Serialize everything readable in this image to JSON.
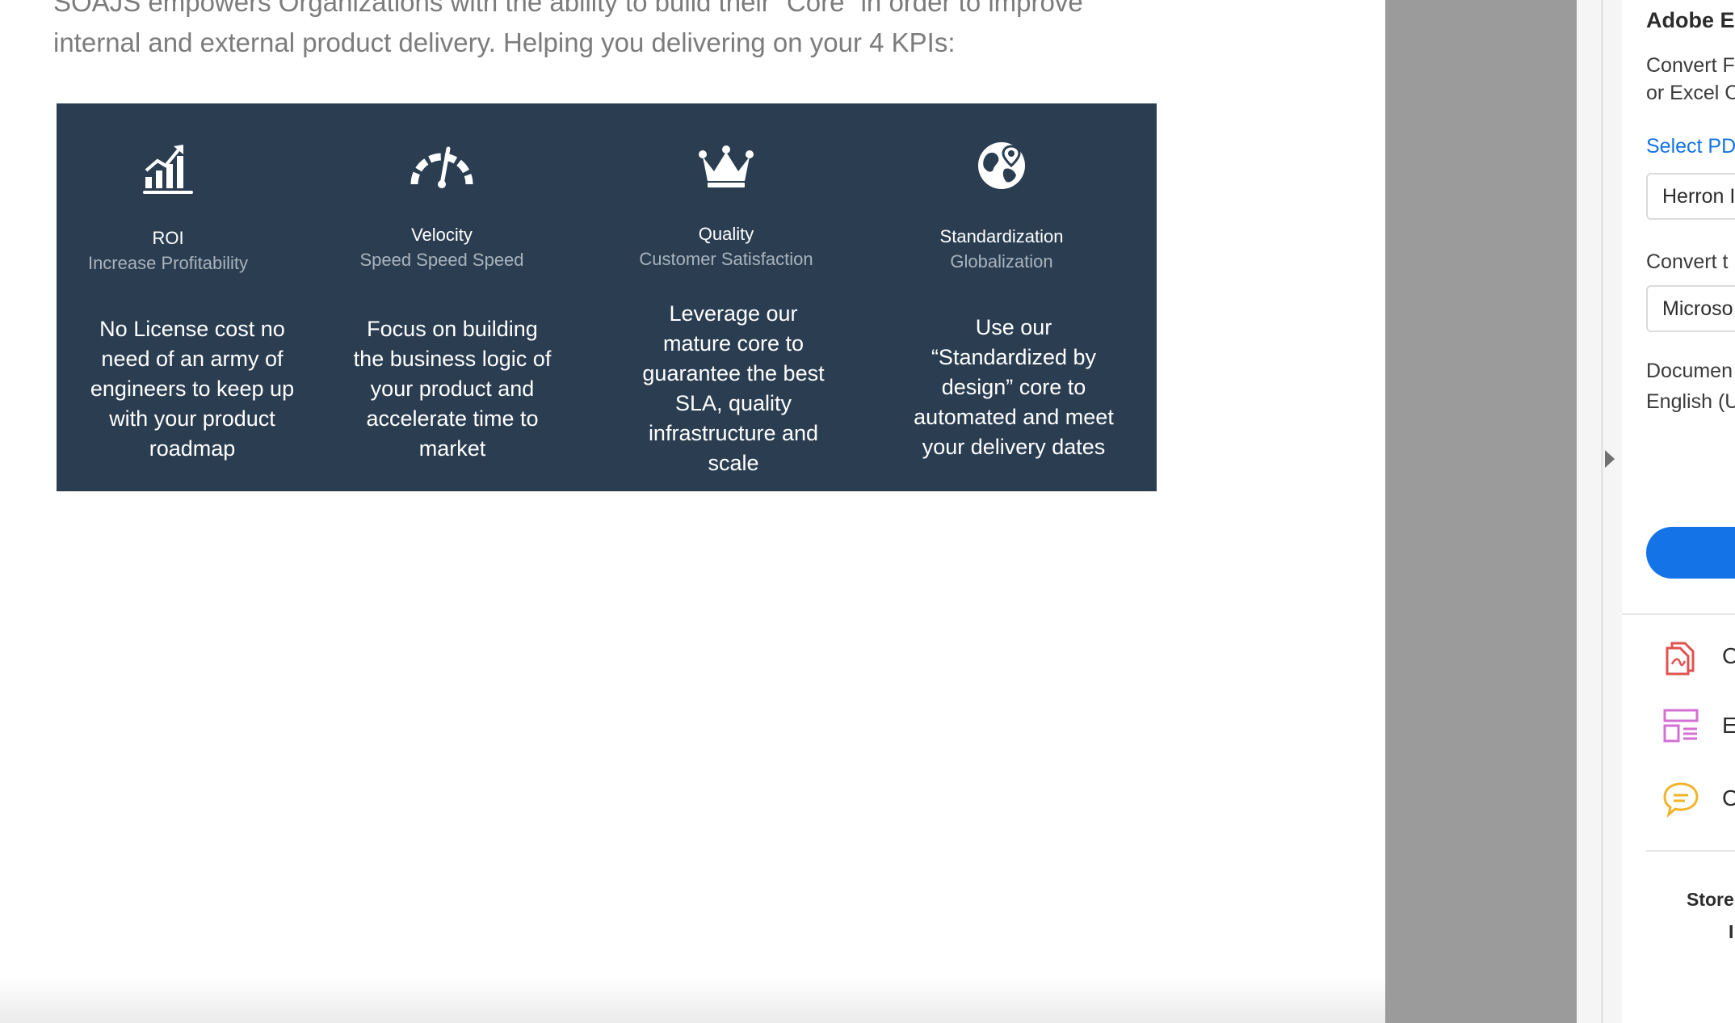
{
  "intro": {
    "line1": "SOAJS empowers Organizations with the ability to build their “Core” in order to improve",
    "line2": "internal and external product delivery. Helping you delivering on your 4 KPIs:"
  },
  "kpis": [
    {
      "icon": "bar-chart-growth-icon",
      "title": "ROI",
      "subtitle": "Increase Profitability",
      "desc": [
        "No License cost no",
        "need of an army of",
        "engineers to keep up",
        "with your product",
        "roadmap"
      ]
    },
    {
      "icon": "speedometer-icon",
      "title": "Velocity",
      "subtitle": "Speed Speed Speed",
      "desc": [
        "Focus on building",
        "the business logic of",
        "your product and",
        "accelerate time to",
        "market"
      ]
    },
    {
      "icon": "crown-icon",
      "title": "Quality",
      "subtitle": "Customer Satisfaction",
      "desc": [
        "Leverage our",
        "mature core to",
        "guarantee the best",
        "SLA, quality",
        "infrastructure and",
        "scale"
      ]
    },
    {
      "icon": "globe-pin-icon",
      "title": "Standardization",
      "subtitle": "Globalization",
      "desc": [
        "Use our",
        "“Standardized by",
        "design” core to",
        "automated and meet",
        "your delivery dates"
      ]
    }
  ],
  "panel": {
    "heading": "Adobe E",
    "desc_line1": "Convert F",
    "desc_line2": "or Excel C",
    "select_link": "Select PD",
    "file_value": "Herron I",
    "convert_label": "Convert t",
    "format_value": "Microso",
    "doc_lang_label": "Documen",
    "doc_lang_value": "English (U",
    "tools": [
      {
        "icon": "create-pdf-icon",
        "label": "C"
      },
      {
        "icon": "edit-pdf-icon",
        "label": "Ed"
      },
      {
        "icon": "comment-icon",
        "label": "C"
      }
    ],
    "store_line1": "Store",
    "store_line2": "I"
  },
  "colors": {
    "banner": "#2b3e51",
    "accent": "#1473e6",
    "gutter": "#9b9b9b"
  }
}
